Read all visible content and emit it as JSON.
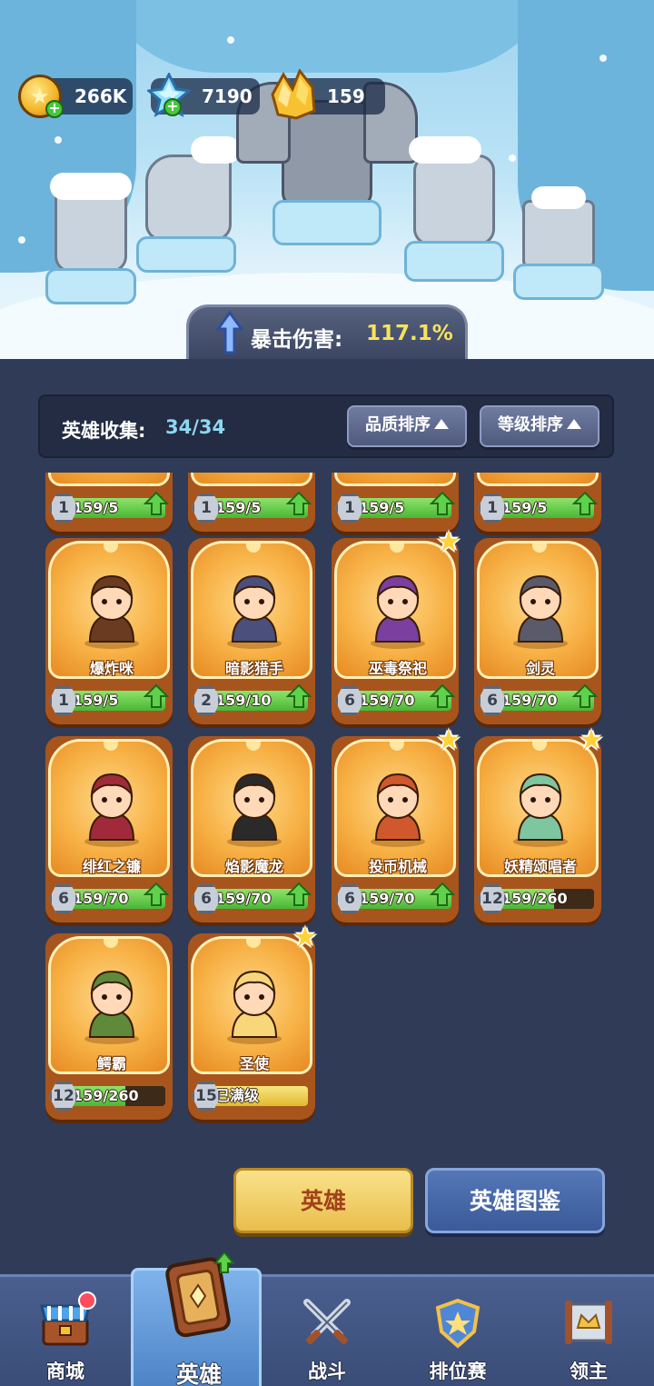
{
  "resources": {
    "coins": "266K",
    "crystals": "7190",
    "gold_gems": "159",
    "coin_icon": "gold-star-coin-icon",
    "crystal_icon": "blue-crystal-icon",
    "gem_icon": "gold-gem-icon"
  },
  "bonus": {
    "label": "暴击伤害:",
    "value": "117.1%"
  },
  "collection": {
    "label": "英雄收集:",
    "count": "34/34",
    "sort_quality": "品质排序",
    "sort_level": "等级排序"
  },
  "heroes_partial": [
    {
      "level": "1",
      "progress": "159/5",
      "ready": true
    },
    {
      "level": "1",
      "progress": "159/5",
      "ready": true
    },
    {
      "level": "1",
      "progress": "159/5",
      "ready": true
    },
    {
      "level": "1",
      "progress": "159/5",
      "ready": true
    }
  ],
  "heroes": [
    {
      "name": "爆炸咪",
      "level": "1",
      "progress": "159/5",
      "fill": 1.0,
      "ready": true,
      "star": false,
      "accent": "#6b3b21"
    },
    {
      "name": "暗影猎手",
      "level": "2",
      "progress": "159/10",
      "fill": 1.0,
      "ready": true,
      "star": false,
      "accent": "#4a4f7c"
    },
    {
      "name": "巫毒祭祀",
      "level": "6",
      "progress": "159/70",
      "fill": 1.0,
      "ready": true,
      "star": true,
      "accent": "#7b3fa0"
    },
    {
      "name": "剑灵",
      "level": "6",
      "progress": "159/70",
      "fill": 1.0,
      "ready": true,
      "star": false,
      "accent": "#5a5a6a"
    },
    {
      "name": "绯红之镰",
      "level": "6",
      "progress": "159/70",
      "fill": 1.0,
      "ready": true,
      "star": false,
      "accent": "#a12a3a"
    },
    {
      "name": "焰影魔龙",
      "level": "6",
      "progress": "159/70",
      "fill": 1.0,
      "ready": true,
      "star": false,
      "accent": "#2a2a2a"
    },
    {
      "name": "投币机械",
      "level": "6",
      "progress": "159/70",
      "fill": 1.0,
      "ready": true,
      "star": true,
      "accent": "#d0582c"
    },
    {
      "name": "妖精颂唱者",
      "level": "12",
      "progress": "159/260",
      "fill": 0.61,
      "ready": false,
      "star": true,
      "accent": "#7ec6a0"
    },
    {
      "name": "鳄霸",
      "level": "12",
      "progress": "159/260",
      "fill": 0.61,
      "ready": false,
      "star": false,
      "accent": "#5f8a3a"
    },
    {
      "name": "圣使",
      "level": "15",
      "progress": "已满级",
      "fill": 1.0,
      "ready": false,
      "star": true,
      "max": true,
      "accent": "#f7d77a"
    }
  ],
  "buttons": {
    "hero": "英雄",
    "codex": "英雄图鉴"
  },
  "nav": [
    {
      "label": "商城",
      "icon": "shop-chest-icon",
      "badge": true
    },
    {
      "label": "英雄",
      "icon": "hero-card-icon",
      "active": true
    },
    {
      "label": "战斗",
      "icon": "crossed-swords-icon"
    },
    {
      "label": "排位赛",
      "icon": "ranked-shield-icon"
    },
    {
      "label": "领主",
      "icon": "lord-banner-icon"
    }
  ]
}
